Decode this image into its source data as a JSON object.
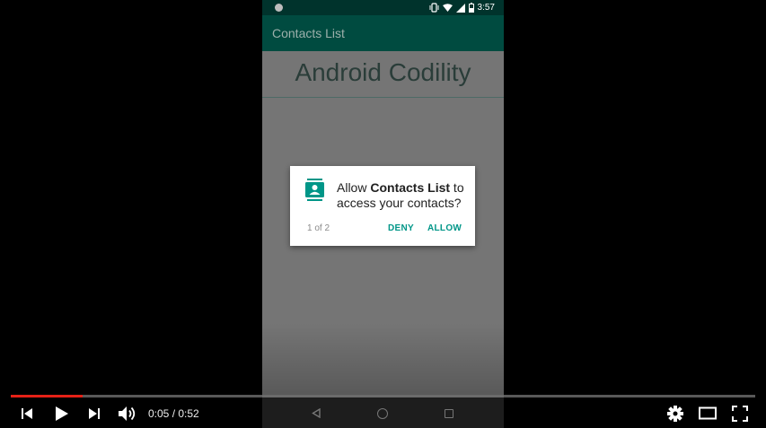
{
  "phone": {
    "status_time": "3:57",
    "app_title": "Contacts List",
    "content_title": "Android Codility"
  },
  "dialog": {
    "message_prefix": "Allow ",
    "message_app": "Contacts List",
    "message_suffix": " to access your contacts?",
    "counter": "1 of 2",
    "deny_label": "DENY",
    "allow_label": "ALLOW",
    "accent_color": "#009688"
  },
  "player": {
    "current_time": "0:05",
    "separator": " / ",
    "duration": "0:52",
    "progress_fraction": 0.096,
    "progress_color": "#e62117"
  }
}
